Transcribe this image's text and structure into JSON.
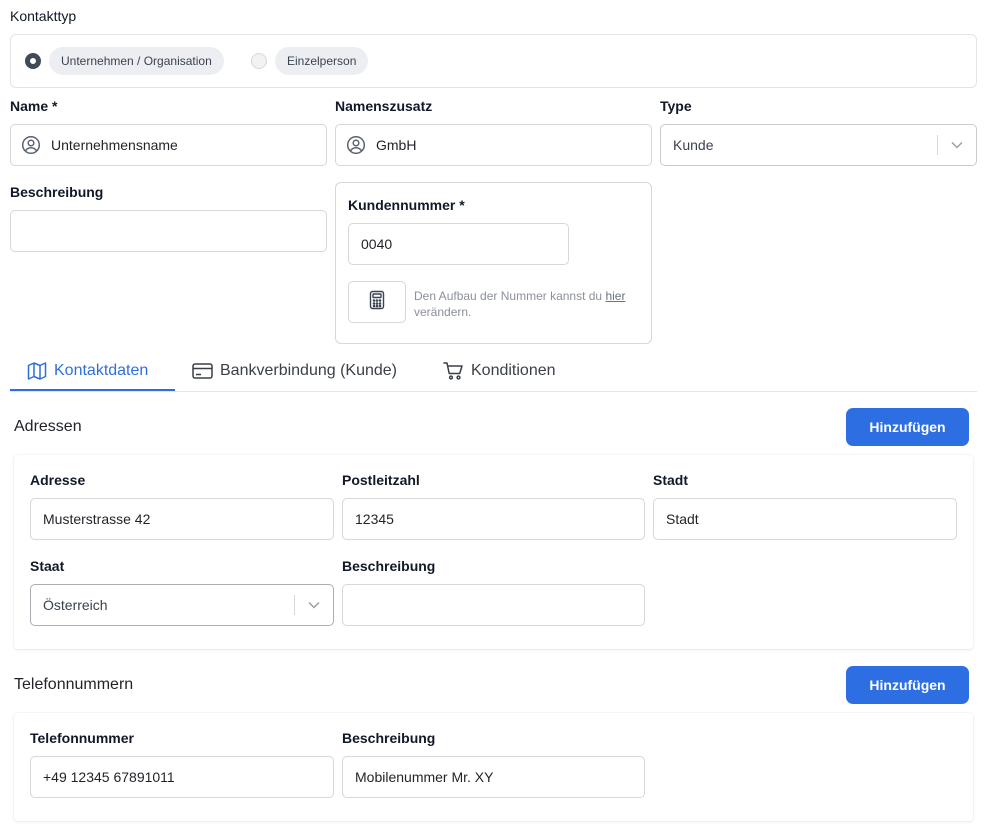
{
  "contact_type": {
    "label": "Kontakttyp",
    "options": [
      {
        "label": "Unternehmen / Organisation",
        "selected": true
      },
      {
        "label": "Einzelperson",
        "selected": false
      }
    ]
  },
  "fields": {
    "name_label": "Name *",
    "name_value": "Unternehmensname",
    "suffix_label": "Namenszusatz",
    "suffix_value": "GmbH",
    "type_label": "Type",
    "type_value": "Kunde",
    "description_label": "Beschreibung",
    "description_value": ""
  },
  "customer_number": {
    "label": "Kundennummer *",
    "value": "0040",
    "hint_prefix": "Den Aufbau der Nummer kannst du",
    "hint_link": "hier",
    "hint_suffix": "verändern."
  },
  "tabs": [
    {
      "label": "Kontaktdaten",
      "icon": "map-icon",
      "active": true
    },
    {
      "label": "Bankverbindung (Kunde)",
      "icon": "credit-card-icon",
      "active": false
    },
    {
      "label": "Konditionen",
      "icon": "cart-icon",
      "active": false
    }
  ],
  "addresses": {
    "title": "Adressen",
    "add_label": "Hinzufügen",
    "address_label": "Adresse",
    "address_value": "Musterstrasse 42",
    "zip_label": "Postleitzahl",
    "zip_value": "12345",
    "city_label": "Stadt",
    "city_placeholder": "Stadt",
    "country_label": "Staat",
    "country_value": "Österreich",
    "description_label": "Beschreibung",
    "description_value": ""
  },
  "phones": {
    "title": "Telefonnummern",
    "add_label": "Hinzufügen",
    "number_label": "Telefonnummer",
    "number_value": "+49 12345 67891011",
    "description_label": "Beschreibung",
    "description_value": "Mobilenummer Mr. XY"
  },
  "colors": {
    "primary": "#2d6fe3",
    "active_tab": "#2f6fdc"
  }
}
